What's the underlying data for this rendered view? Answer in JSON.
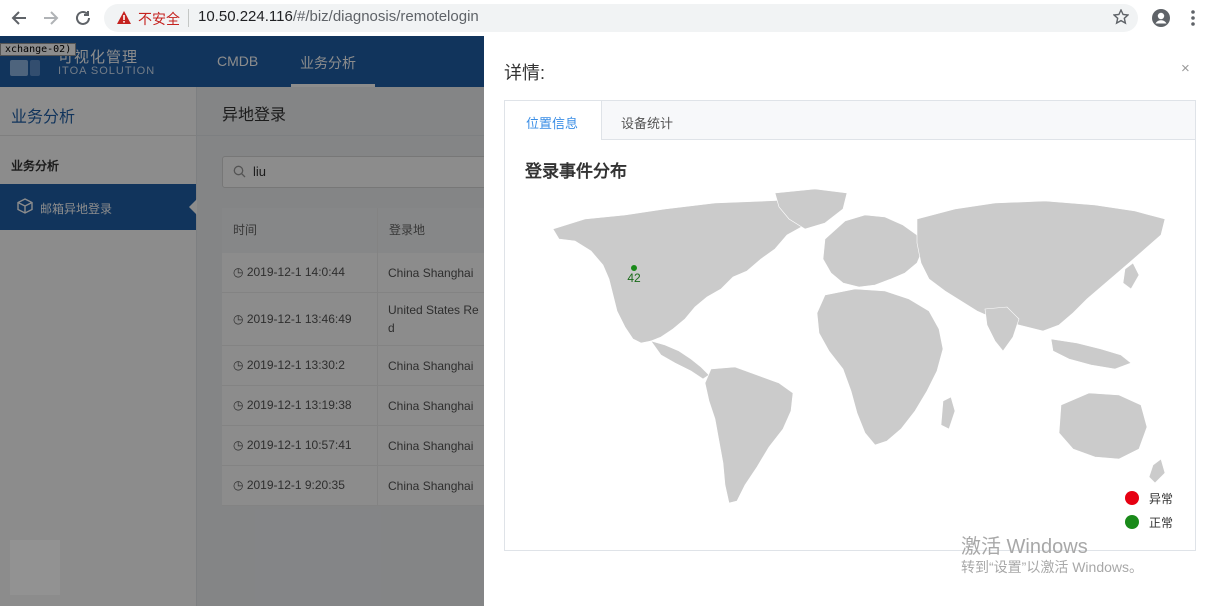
{
  "browser": {
    "insecure_label": "不安全",
    "url_host": "10.50.224.116",
    "url_path": "/#/biz/diagnosis/remotelogin"
  },
  "app": {
    "logo_title": "可视化管理",
    "logo_subtitle": "ITOA SOLUTION",
    "tooltip": "xchange-02)",
    "nav": [
      "CMDB",
      "业务分析"
    ],
    "sidebar": {
      "title": "业务分析",
      "section": "业务分析",
      "active_item": "邮箱异地登录"
    },
    "page_title": "异地登录",
    "search_value": "liu",
    "table": {
      "headers": [
        "时间",
        "登录地"
      ],
      "rows": [
        {
          "time": "2019-12-1 14:0:44",
          "location": "China Shanghai"
        },
        {
          "time": "2019-12-1 13:46:49",
          "location": "United States Red"
        },
        {
          "time": "2019-12-1 13:30:2",
          "location": "China Shanghai"
        },
        {
          "time": "2019-12-1 13:19:38",
          "location": "China Shanghai"
        },
        {
          "time": "2019-12-1 10:57:41",
          "location": "China Shanghai"
        },
        {
          "time": "2019-12-1 9:20:35",
          "location": "China Shanghai"
        }
      ]
    }
  },
  "drawer": {
    "title": "详情:",
    "close_label": "×",
    "tabs": [
      "位置信息",
      "设备统计"
    ],
    "map_title": "登录事件分布",
    "marker_value": "42",
    "legend": [
      {
        "label": "异常",
        "color": "#e60012"
      },
      {
        "label": "正常",
        "color": "#1a8a1a"
      }
    ],
    "accent_color": "#3a8ee6"
  },
  "watermark": {
    "line1": "激活 Windows",
    "line2": "转到“设置”以激活 Windows。"
  }
}
